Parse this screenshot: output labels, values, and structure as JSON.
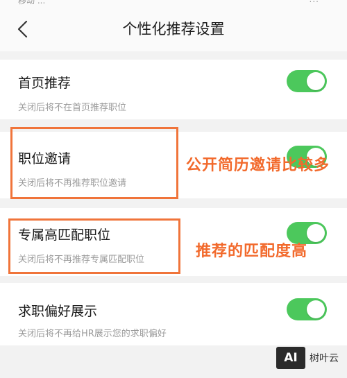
{
  "status": {
    "left": "移动 ...",
    "right": "..."
  },
  "header": {
    "title": "个性化推荐设置",
    "back_icon": "chevron-left-icon"
  },
  "settings": [
    {
      "label": "首页推荐",
      "desc": "关闭后将不在首页推荐职位",
      "enabled": true
    },
    {
      "label": "职位邀请",
      "desc": "关闭后将不再推荐职位邀请",
      "enabled": true
    },
    {
      "label": "专属高匹配职位",
      "desc": "关闭后将不再推荐专属匹配职位",
      "enabled": true
    },
    {
      "label": "求职偏好展示",
      "desc": "关闭后将不再给HR展示您的求职偏好",
      "enabled": true
    }
  ],
  "annotations": [
    {
      "text": "公开简历邀请比较多"
    },
    {
      "text": "推荐的匹配度高"
    }
  ],
  "watermark": {
    "logo": "AI",
    "text": "树叶云"
  },
  "colors": {
    "toggle_on": "#4cc85c",
    "annotation": "#f26a2c",
    "background": "#f2f2f2"
  }
}
